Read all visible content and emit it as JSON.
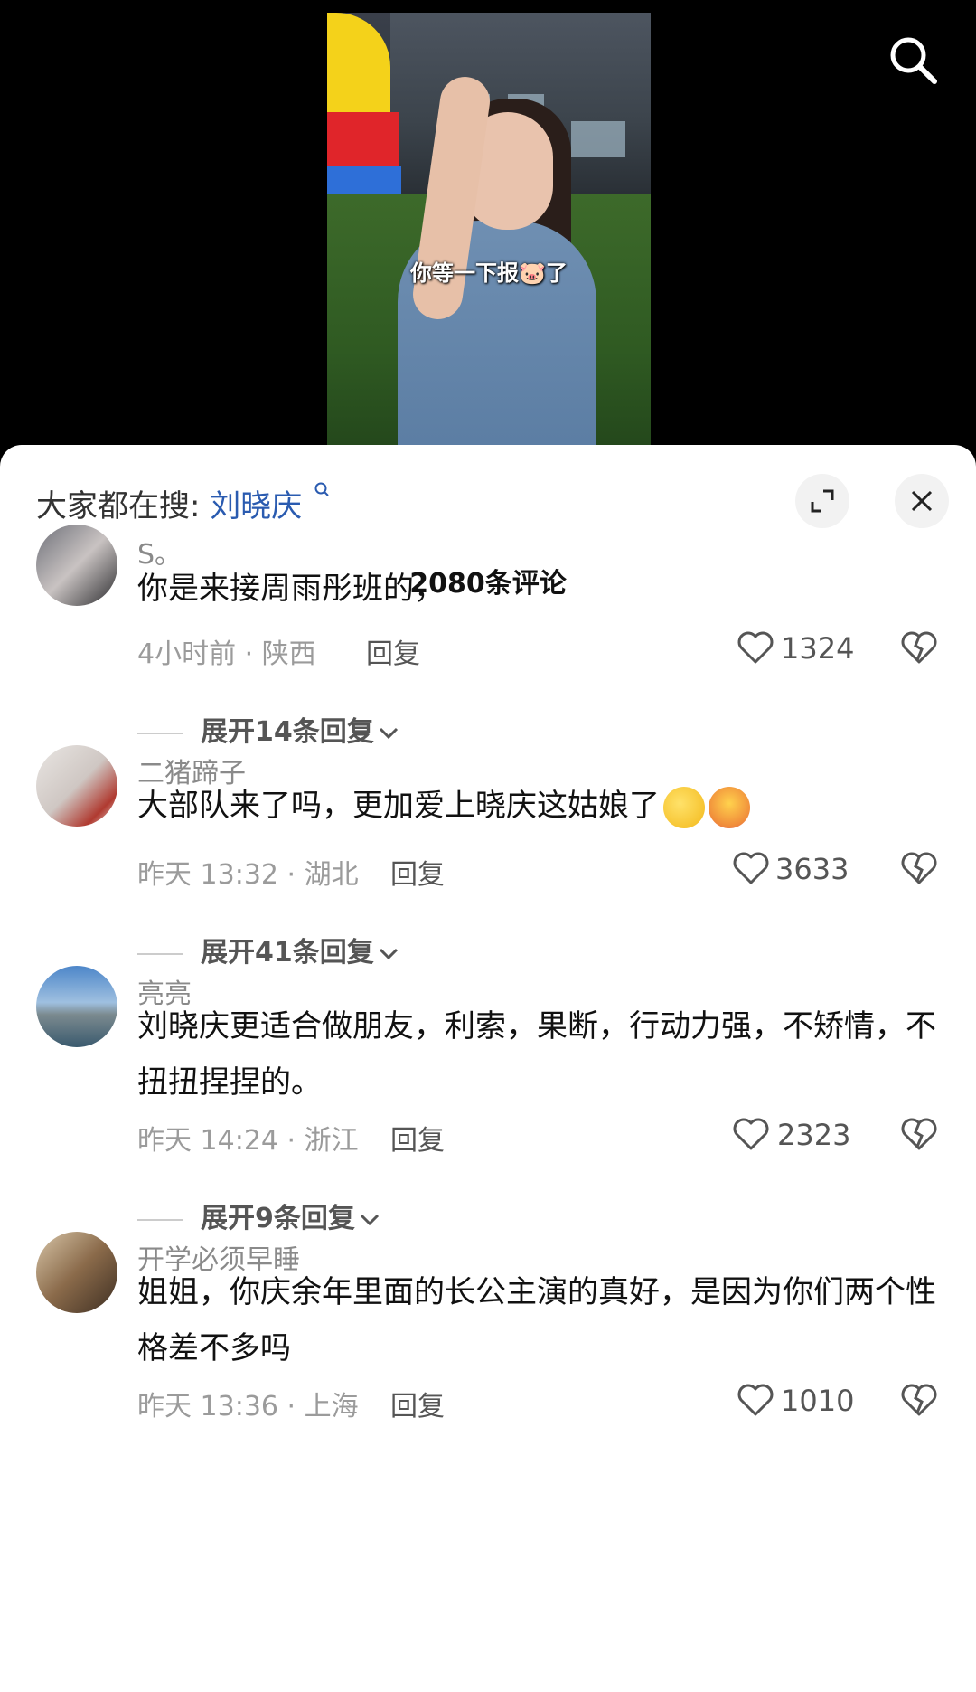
{
  "video": {
    "subtitle": "你等一下报🐷了"
  },
  "header": {
    "hot_search_prefix": "大家都在搜:",
    "hot_search_keyword": "刘晓庆",
    "comment_count": "2080条评论"
  },
  "comments": [
    {
      "username": "S。",
      "text": "你是来接周雨彤班的，",
      "time_location": "4小时前 · 陕西",
      "reply_label": "回复",
      "likes": "1324",
      "expand_label": "展开14条回复"
    },
    {
      "username": "二猪蹄子",
      "text": "大部队来了吗，更加爱上晓庆这姑娘了",
      "time_location": "昨天 13:32 · 湖北",
      "reply_label": "回复",
      "likes": "3633",
      "expand_label": "展开41条回复"
    },
    {
      "username": "亮亮",
      "text": "刘晓庆更适合做朋友，利索，果断，行动力强，不矫情，不扭扭捏捏的。",
      "time_location": "昨天 14:24 · 浙江",
      "reply_label": "回复",
      "likes": "2323",
      "expand_label": "展开9条回复"
    },
    {
      "username": "开学必须早睡",
      "text": "姐姐，你庆余年里面的长公主演的真好，是因为你们两个性格差不多吗",
      "time_location": "昨天 13:36 · 上海",
      "reply_label": "回复",
      "likes": "1010"
    }
  ],
  "icons": {
    "search": "search-icon",
    "expand": "expand-icon",
    "close": "close-icon",
    "like": "heart-icon",
    "dislike": "broken-heart-icon"
  },
  "colors": {
    "keyword": "#2a5bb0",
    "meta": "#9b9b9b",
    "username": "#8a8a8a"
  }
}
